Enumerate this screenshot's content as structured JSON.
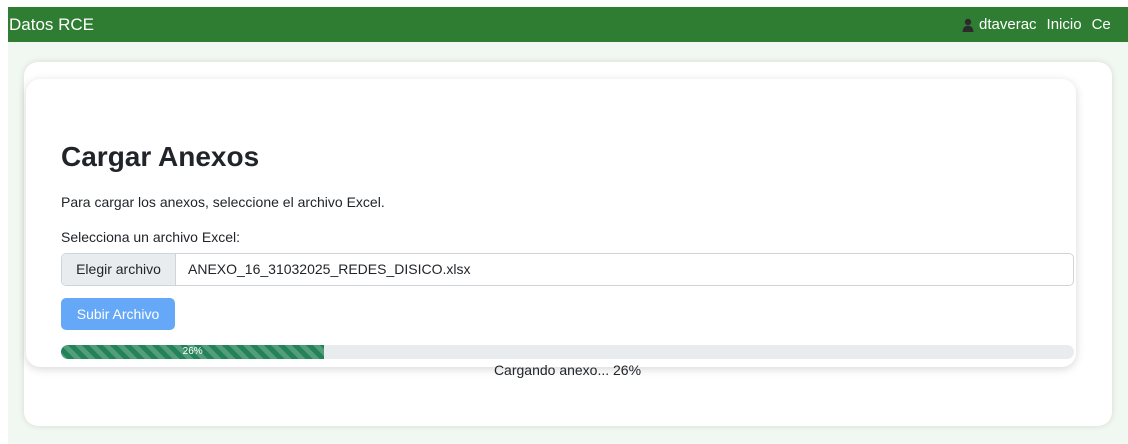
{
  "navbar": {
    "brand": "Datos RCE",
    "user_icon": "user-icon",
    "username": "dtaverac",
    "links": [
      {
        "label": "Inicio"
      },
      {
        "label": "Ce"
      }
    ]
  },
  "form": {
    "title": "Cargar Anexos",
    "description": "Para cargar los anexos, seleccione el archivo Excel.",
    "file_label": "Selecciona un archivo Excel:",
    "file_button_label": "Elegir archivo",
    "selected_file": "ANEXO_16_31032025_REDES_DISICO.xlsx",
    "submit_label": "Subir Archivo"
  },
  "progress": {
    "value_percent": 26,
    "label": "26%",
    "status": "Cargando anexo... 26%"
  },
  "colors": {
    "navbar_bg": "#2e7d32",
    "page_bg": "#f1f8f1",
    "progress_fill": "#238257",
    "submit_button_bg": "#65a8f8"
  }
}
